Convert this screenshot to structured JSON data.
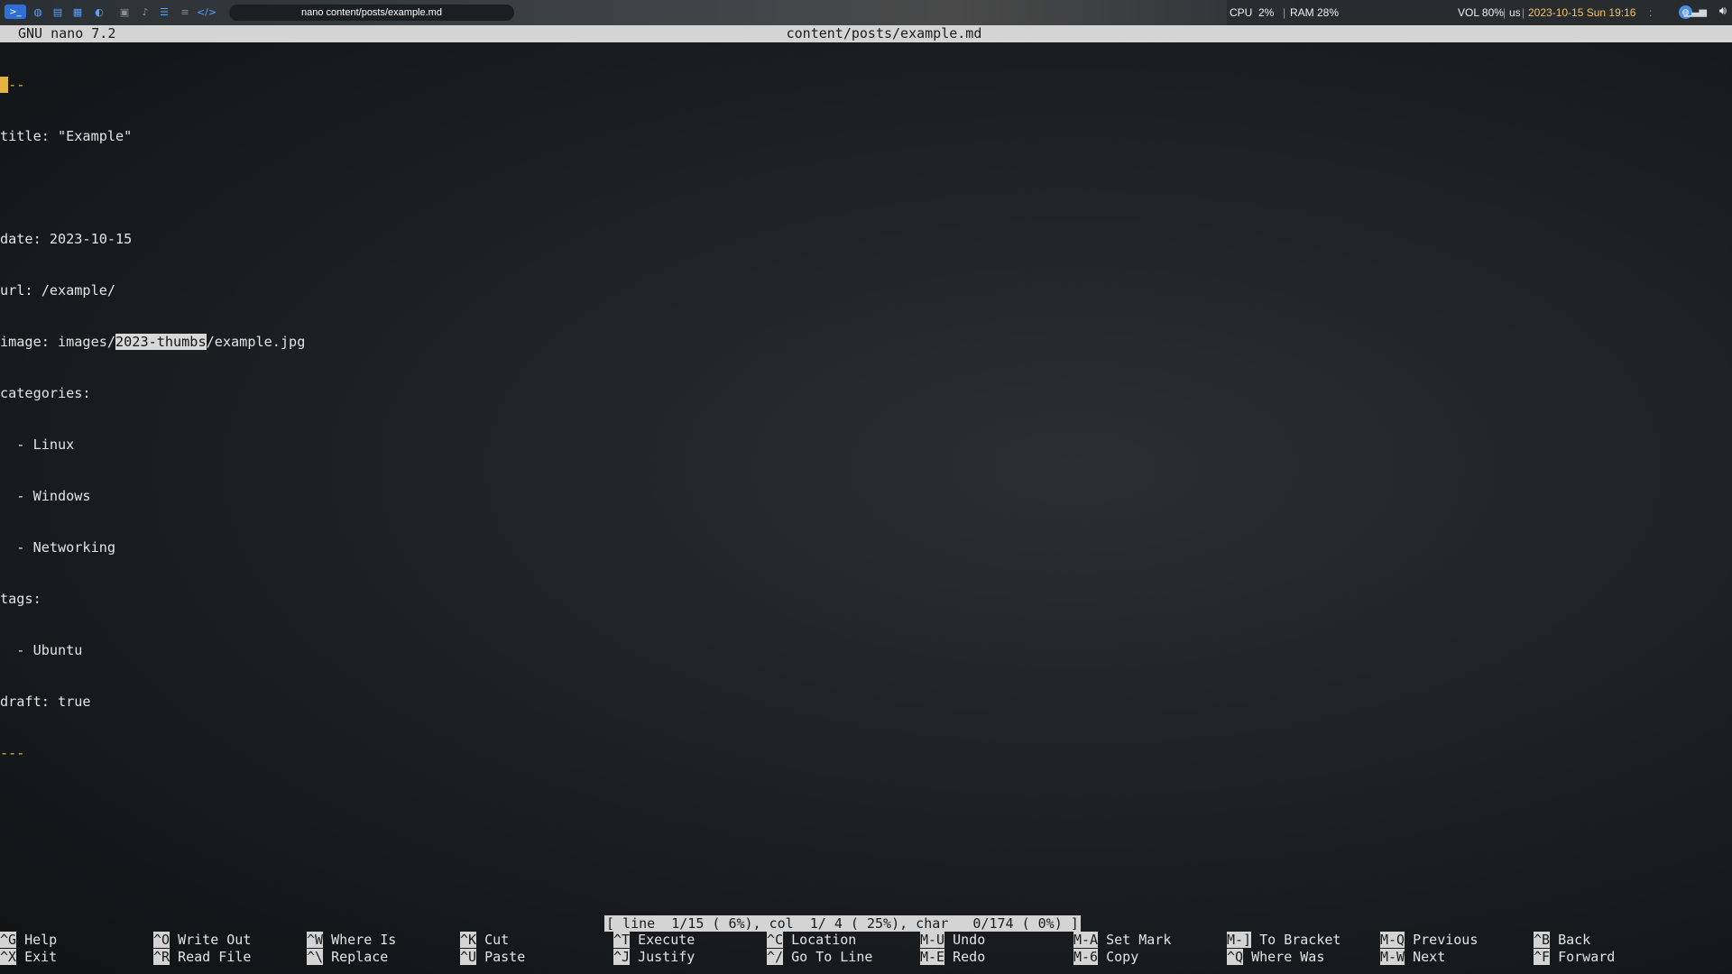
{
  "topbar": {
    "icons": [
      "terminal-icon",
      "globe-icon",
      "files-icon",
      "apps-icon",
      "gamepad-icon",
      "image-icon",
      "microphone-icon",
      "panel-icon",
      "layout-icon",
      "code-icon"
    ],
    "window_title": "nano content/posts/example.md",
    "cpu": "CPU  2%",
    "ram": "RAM 28%",
    "vol": "VOL 80%",
    "kb_layout": "us",
    "datetime": "2023-10-15 Sun 19:16"
  },
  "nano": {
    "version": "GNU nano 7.2",
    "filename": "content/posts/example.md",
    "lines": [
      "---",
      "title: \"Example\"",
      "",
      "date: 2023-10-15",
      "url: /example/",
      "image: images/2023-thumbs/example.jpg",
      "categories:",
      "  - Linux",
      "  - Windows",
      "  - Networking",
      "tags:",
      "  - Ubuntu",
      "draft: true",
      "---"
    ],
    "image_prefix": "image: images/",
    "image_highlight": "2023-thumbs",
    "image_suffix": "/example.jpg",
    "status": "[ line  1/15 ( 6%), col  1/ 4 ( 25%), char   0/174 ( 0%) ]",
    "colors": {
      "accent": "#e3b341",
      "bar": "#d4d4d4"
    },
    "shortcuts": [
      {
        "key": "^G",
        "label": "Help"
      },
      {
        "key": "^X",
        "label": "Exit"
      },
      {
        "key": "^O",
        "label": "Write Out"
      },
      {
        "key": "^R",
        "label": "Read File"
      },
      {
        "key": "^W",
        "label": "Where Is"
      },
      {
        "key": "^\\",
        "label": "Replace"
      },
      {
        "key": "^K",
        "label": "Cut"
      },
      {
        "key": "^U",
        "label": "Paste"
      },
      {
        "key": "^T",
        "label": "Execute"
      },
      {
        "key": "^J",
        "label": "Justify"
      },
      {
        "key": "^C",
        "label": "Location"
      },
      {
        "key": "^/",
        "label": "Go To Line"
      },
      {
        "key": "M-U",
        "label": "Undo"
      },
      {
        "key": "M-E",
        "label": "Redo"
      },
      {
        "key": "M-A",
        "label": "Set Mark"
      },
      {
        "key": "M-6",
        "label": "Copy"
      },
      {
        "key": "M-]",
        "label": "To Bracket"
      },
      {
        "key": "^Q",
        "label": "Where Was"
      },
      {
        "key": "M-Q",
        "label": "Previous"
      },
      {
        "key": "M-W",
        "label": "Next"
      },
      {
        "key": "^B",
        "label": "Back"
      },
      {
        "key": "^F",
        "label": "Forward"
      }
    ]
  }
}
